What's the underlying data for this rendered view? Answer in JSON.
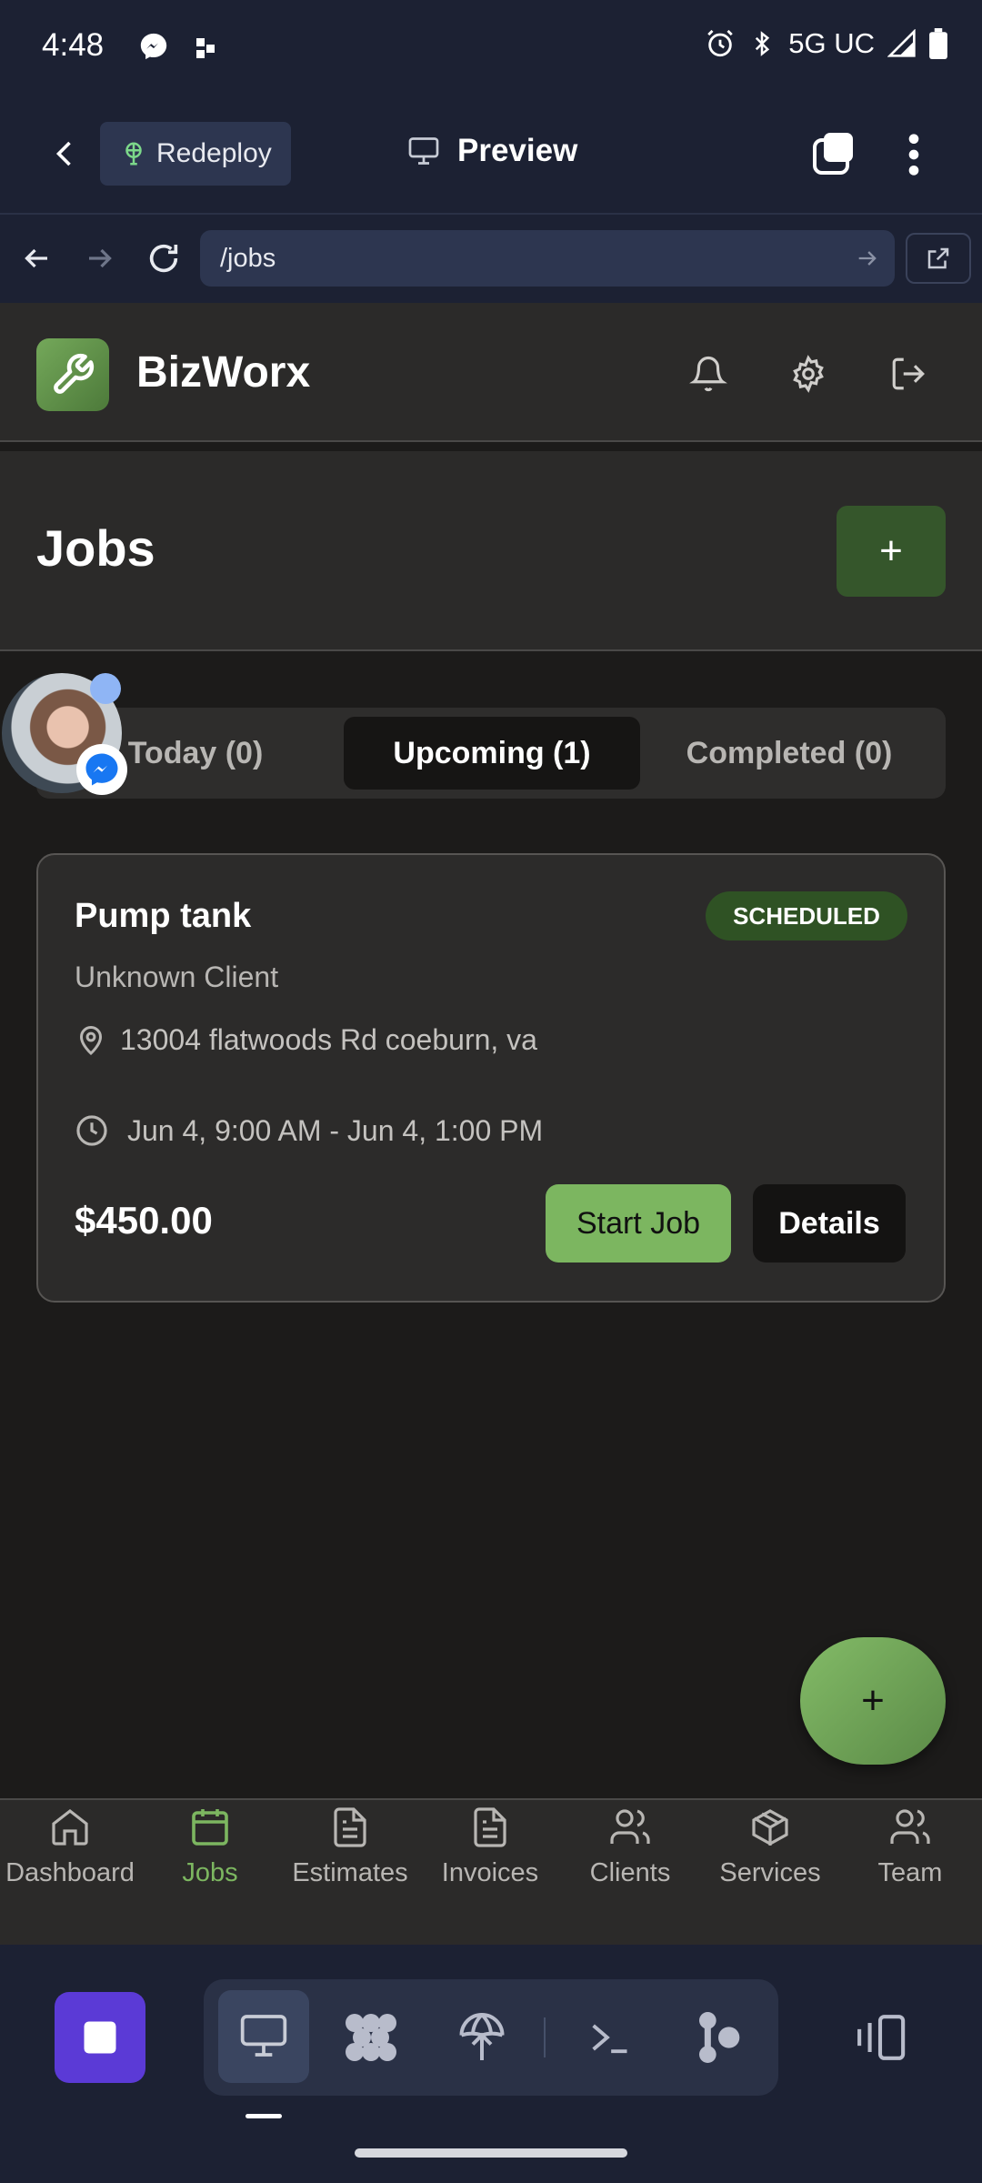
{
  "status_bar": {
    "time": "4:48",
    "network": "5G UC"
  },
  "replit_header": {
    "redeploy_label": "Redeploy",
    "preview_label": "Preview",
    "url": "/jobs"
  },
  "app": {
    "brand": "BizWorx",
    "page_title": "Jobs",
    "add_label": "+"
  },
  "tabs": [
    {
      "label": "Today (0)"
    },
    {
      "label": "Upcoming (1)"
    },
    {
      "label": "Completed (0)"
    }
  ],
  "job": {
    "title": "Pump tank",
    "status": "SCHEDULED",
    "client": "Unknown Client",
    "address": "13004 flatwoods Rd coeburn, va",
    "time": "Jun 4, 9:00 AM - Jun 4, 1:00 PM",
    "price": "$450.00",
    "start_label": "Start Job",
    "details_label": "Details"
  },
  "fab_label": "+",
  "nav": [
    {
      "label": "Dashboard",
      "icon": "home-icon"
    },
    {
      "label": "Jobs",
      "icon": "calendar-icon"
    },
    {
      "label": "Estimates",
      "icon": "document-icon"
    },
    {
      "label": "Invoices",
      "icon": "document-icon"
    },
    {
      "label": "Clients",
      "icon": "users-icon"
    },
    {
      "label": "Services",
      "icon": "package-icon"
    },
    {
      "label": "Team",
      "icon": "users-icon"
    }
  ],
  "colors": {
    "accent_green": "#7cb660",
    "badge_green": "#2f5224",
    "dock_purple": "#5b3ad6"
  }
}
